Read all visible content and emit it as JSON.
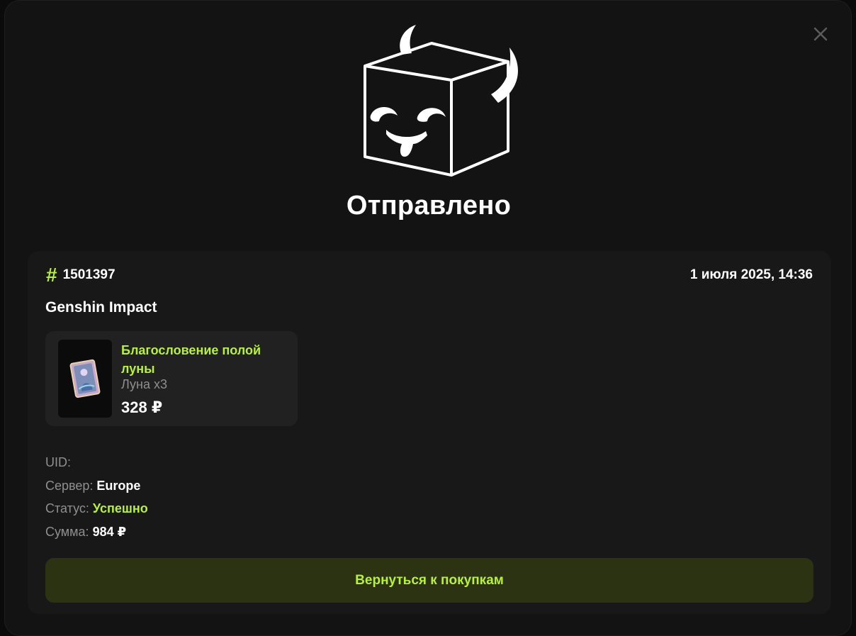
{
  "modal": {
    "title": "Отправлено",
    "mascot_icon": "horned-cube-mascot-icon",
    "close_icon": "close-icon"
  },
  "order": {
    "hash_symbol": "#",
    "number": "1501397",
    "date": "1 июля 2025, 14:36",
    "game": "Genshin Impact"
  },
  "product": {
    "name": "Благословение полой луны",
    "qty": "Луна x3",
    "price": "328 ₽",
    "thumb_icon": "welkin-moon-card-icon"
  },
  "details": {
    "uid_label": "UID:",
    "uid_value": "",
    "server_label": "Сервер:",
    "server_value": "Europe",
    "status_label": "Статус:",
    "status_value": "Успешно",
    "sum_label": "Сумма:",
    "sum_value": "984 ₽"
  },
  "actions": {
    "back_label": "Вернуться к покупкам"
  },
  "colors": {
    "accent": "#b8f13a",
    "modal_bg": "#131313",
    "card_bg": "#181818",
    "product_bg": "#212121",
    "button_bg": "#2c3313",
    "muted_text": "#8f8f8f"
  }
}
